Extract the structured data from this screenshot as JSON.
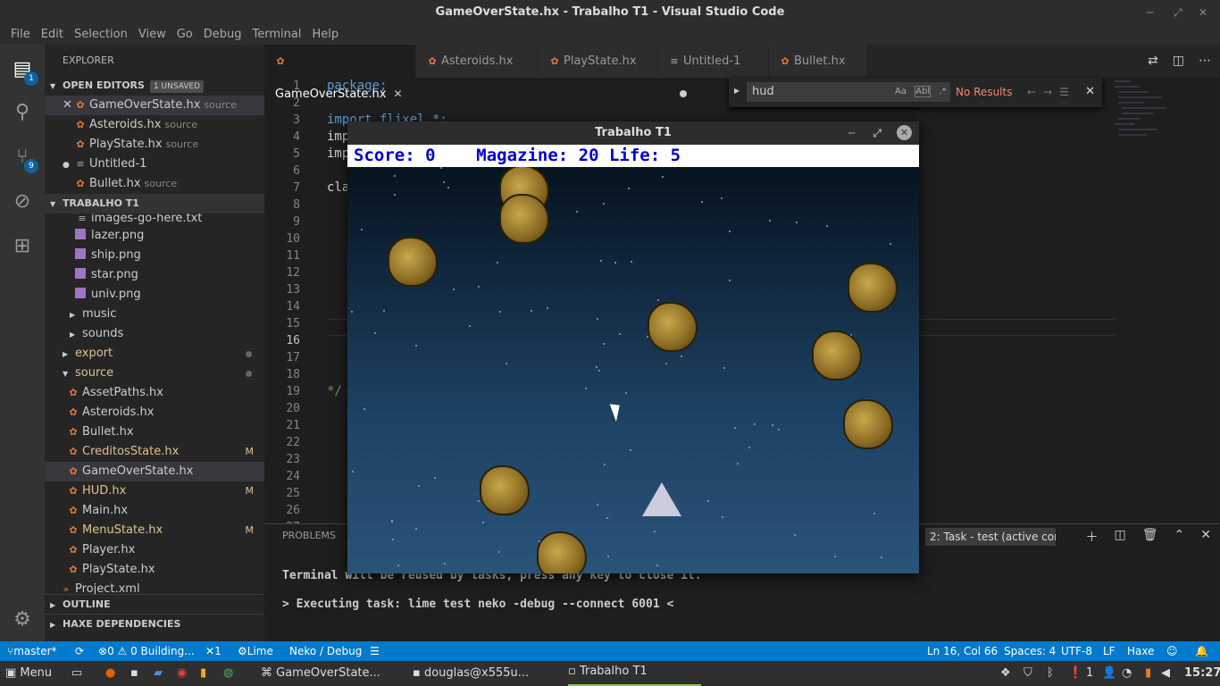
{
  "window": {
    "title": "GameOverState.hx - Trabalho T1 - Visual Studio Code"
  },
  "menu": [
    "File",
    "Edit",
    "Selection",
    "View",
    "Go",
    "Debug",
    "Terminal",
    "Help"
  ],
  "activity": {
    "explorer_badge": "1",
    "scm_badge": "9"
  },
  "sidebar": {
    "title": "EXPLORER",
    "open_editors": {
      "label": "OPEN EDITORS",
      "unsaved": "1 UNSAVED",
      "items": [
        {
          "name": "GameOverState.hx",
          "desc": "source"
        },
        {
          "name": "Asteroids.hx",
          "desc": "source"
        },
        {
          "name": "PlayState.hx",
          "desc": "source"
        },
        {
          "name": "Untitled-1",
          "desc": ""
        },
        {
          "name": "Bullet.hx",
          "desc": "source"
        }
      ]
    },
    "project": {
      "label": "TRABALHO T1",
      "items": [
        {
          "name": "images-go-here.txt"
        },
        {
          "name": "lazer.png"
        },
        {
          "name": "ship.png"
        },
        {
          "name": "star.png"
        },
        {
          "name": "univ.png"
        },
        {
          "name": "music"
        },
        {
          "name": "sounds"
        },
        {
          "name": "export"
        },
        {
          "name": "source"
        },
        {
          "name": "AssetPaths.hx"
        },
        {
          "name": "Asteroids.hx"
        },
        {
          "name": "Bullet.hx"
        },
        {
          "name": "CreditosState.hx",
          "status": "M"
        },
        {
          "name": "GameOverState.hx"
        },
        {
          "name": "HUD.hx",
          "status": "M"
        },
        {
          "name": "Main.hx"
        },
        {
          "name": "MenuState.hx",
          "status": "M"
        },
        {
          "name": "Player.hx"
        },
        {
          "name": "PlayState.hx"
        },
        {
          "name": "Project.xml"
        }
      ]
    },
    "outline": "OUTLINE",
    "haxe_deps": "HAXE DEPENDENCIES"
  },
  "tabs": [
    {
      "label": "GameOverState.hx"
    },
    {
      "label": "Asteroids.hx"
    },
    {
      "label": "PlayState.hx"
    },
    {
      "label": "Untitled-1"
    },
    {
      "label": "Bullet.hx"
    }
  ],
  "code": {
    "line_numbers": [
      "1",
      "2",
      "3",
      "4",
      "5",
      "6",
      "7",
      "8",
      "9",
      "10",
      "11",
      "12",
      "13",
      "14",
      "15",
      "16",
      "17",
      "18",
      "19",
      "20",
      "21",
      "22",
      "23",
      "24",
      "25",
      "26",
      "27"
    ],
    "lines": [
      "package;",
      "",
      "import flixel.*;",
      "imp",
      "imp",
      "",
      "cla",
      "",
      "",
      "",
      "",
      "",
      "",
      "",
      "",
      "",
      "",
      "",
      "*/",
      "",
      "",
      "",
      "",
      "",
      "",
      "",
      ""
    ]
  },
  "find": {
    "query": "hud",
    "case": "Aa",
    "word": "Abl",
    "regex": ".*",
    "result": "No Results"
  },
  "panel": {
    "title": "PROBLEMS",
    "terminal_select": "2: Task - test (active cor",
    "line1": "Terminal will be reused by tasks, press any key to close it.",
    "line2": "> Executing task: lime test neko -debug --connect 6001 <"
  },
  "game": {
    "title": "Trabalho T1",
    "hud": "Score: 0    Magazine: 20 Life: 5"
  },
  "statusbar": {
    "branch": "master*",
    "problems": "0 ⚠ 0 Building...",
    "tools": "1",
    "lime": "Lime",
    "target": "Neko / Debug",
    "position": "Ln 16, Col 66",
    "spaces": "Spaces: 4",
    "encoding": "UTF-8",
    "eol": "LF",
    "lang": "Haxe"
  },
  "taskbar": {
    "menu": "Menu",
    "win1": "GameOverState...",
    "win2": "douglas@x555u...",
    "win3": "Trabalho T1",
    "notif_count": "1",
    "clock": "15:27"
  },
  "colors": {
    "accent": "#007acc",
    "hud_text": "#0000d0",
    "modified": "#e2c08d"
  }
}
